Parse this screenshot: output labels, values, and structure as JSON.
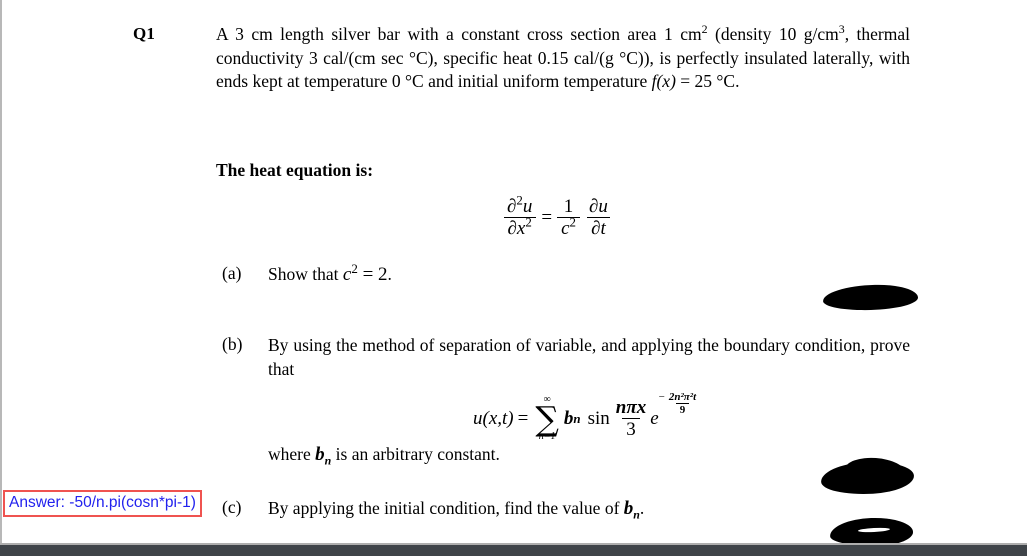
{
  "document": {
    "question_label": "Q1",
    "intro": {
      "line1_pre": "A 3 cm length silver bar with a constant cross section area 1 cm",
      "line1_sup": "2",
      "line1_mid": " (density 10 g/cm",
      "line1_sup2": "3",
      "line1_end": ", thermal conductivity 3 cal/(cm sec °C), specific heat 0.15 cal/(g °C)), is perfectly insulated laterally, with ends kept at temperature 0 °C and initial uniform temperature ",
      "temperature_symbol": "f(x)",
      "temperature_value": " = 25 °C."
    },
    "heat_equation_intro": "The heat equation is:",
    "heat_equation": {
      "lhs_num_partial": "∂",
      "lhs_num_order": "2",
      "lhs_num_var": "u",
      "lhs_den_partial": "∂",
      "lhs_den_var": "x",
      "lhs_den_order": "2",
      "equals": "=",
      "rhs1_num": "1",
      "rhs1_den_var": "c",
      "rhs1_den_order": "2",
      "rhs2_num_partial": "∂",
      "rhs2_num_var": "u",
      "rhs2_den_partial": "∂",
      "rhs2_den_var": "t"
    },
    "parts": [
      {
        "label": "(a)",
        "text_pre": "Show that ",
        "math_var": "c",
        "math_sup": "2",
        "math_rest": " = 2",
        "text_end": "."
      },
      {
        "label": "(b)",
        "text": "By using the method of separation of variable, and applying the boundary condition, prove that",
        "formula": {
          "lhs": "u(x,t)",
          "equals": "=",
          "sum_upper": "∞",
          "sum_glyph": "∑",
          "sum_lower": "n=1",
          "coefficient": "b",
          "coefficient_sub": "n",
          "sin": "sin",
          "sin_arg_num": "nπx",
          "sin_arg_den": "3",
          "exp_base": "e",
          "exp_sign": "−",
          "exp_num": "2n²π²t",
          "exp_den": "9"
        },
        "note_pre": "where ",
        "note_var": "b",
        "note_var_sub": "n",
        "note_post": " is an arbitrary constant."
      },
      {
        "label": "(c)",
        "text_pre": "By applying the initial condition, find the value of ",
        "math_var": "b",
        "math_sub": "n",
        "text_end": "."
      }
    ]
  },
  "annotation": {
    "answer_text": "Answer: -50/n.pi(cosn*pi-1)",
    "box_border_color": "#ef5350",
    "text_color": "#2222ee"
  },
  "redactions": {
    "count": 3,
    "color": "#000000",
    "description": "black-marker-blob"
  },
  "page": {
    "background_color": "#ffffff",
    "bottom_bar_color": "#3f4449"
  }
}
